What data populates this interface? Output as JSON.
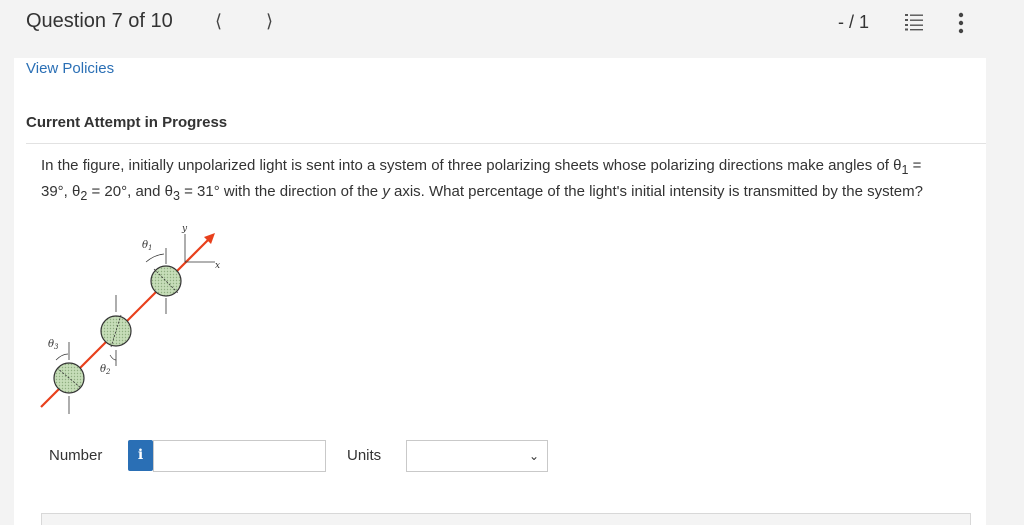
{
  "header": {
    "question_counter": "Question 7 of 10",
    "prev_icon": "chevron-left-icon",
    "next_icon": "chevron-right-icon",
    "score": "- / 1",
    "list_icon": "list-icon",
    "more_icon": "more-vertical-icon"
  },
  "policies_link": "View Policies",
  "attempt_heading": "Current Attempt in Progress",
  "question": {
    "line1_pre": "In the figure, initially unpolarized light is sent into a system of three polarizing sheets whose polarizing directions make angles of θ",
    "line1_sub": "1",
    "line1_post": " =",
    "line2_a": "39°, θ",
    "line2_sub2": "2",
    "line2_b": " = 20°, and θ",
    "line2_sub3": "3",
    "line2_c": " = 31° with the direction of the ",
    "line2_y": "y",
    "line2_d": " axis. What percentage of the light's initial intensity is transmitted by the system?"
  },
  "figure": {
    "label_theta1": "θ",
    "label_theta1_sub": "1",
    "label_theta2": "θ",
    "label_theta2_sub": "2",
    "label_theta3": "θ",
    "label_theta3_sub": "3",
    "axis_y": "y",
    "axis_x": "x",
    "beam_color": "#e8401c",
    "sheet_color": "#c6ddb8"
  },
  "answer": {
    "number_label": "Number",
    "info_icon": "i",
    "number_value": "",
    "units_label": "Units",
    "units_selected": ""
  },
  "colors": {
    "link": "#2a6fb5",
    "background": "#f3f3f3",
    "panel": "#ffffff"
  }
}
